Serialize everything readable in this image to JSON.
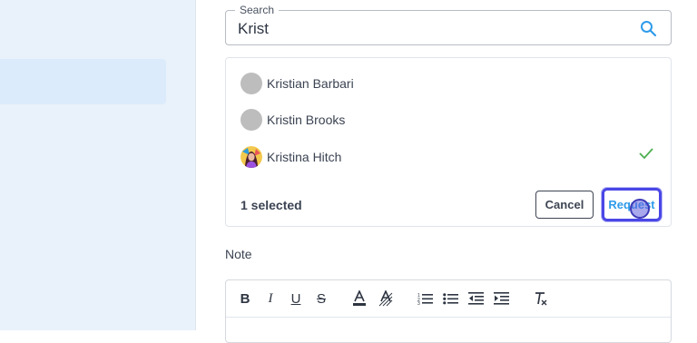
{
  "search": {
    "label": "Search",
    "value": "Krist",
    "icon": "search-icon"
  },
  "options": [
    {
      "name": "Kristian Barbari",
      "avatar": "placeholder",
      "selected": false
    },
    {
      "name": "Kristin Brooks",
      "avatar": "placeholder",
      "selected": false
    },
    {
      "name": "Kristina Hitch",
      "avatar": "photo",
      "selected": true
    }
  ],
  "footer": {
    "selected_text": "1 selected",
    "cancel_label": "Cancel",
    "request_label": "Request"
  },
  "note": {
    "label": "Note",
    "toolbar": [
      "bold-icon",
      "italic-icon",
      "underline-icon",
      "strikethrough-icon",
      "text-color-icon",
      "highlight-icon",
      "ordered-list-icon",
      "bullet-list-icon",
      "outdent-icon",
      "indent-icon",
      "clear-format-icon"
    ]
  },
  "colors": {
    "accent": "#2f9bea",
    "focus_ring": "#4a47e6",
    "check": "#4caf50",
    "sidebar_bg": "#e9f1fa"
  }
}
